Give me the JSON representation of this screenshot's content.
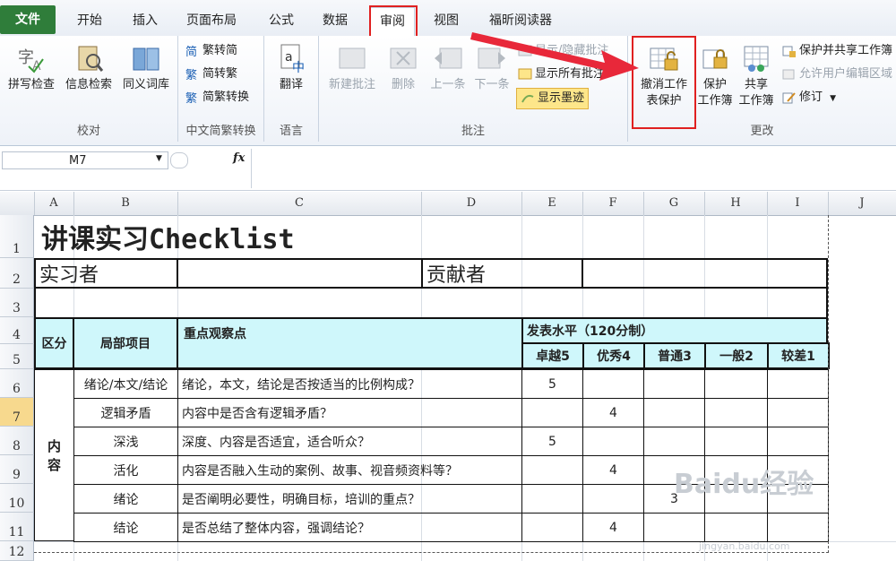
{
  "tabs": {
    "file": "文件",
    "items": [
      "开始",
      "插入",
      "页面布局",
      "公式",
      "数据",
      "审阅",
      "视图",
      "福昕阅读器"
    ],
    "active": "审阅"
  },
  "ribbon": {
    "proofing": {
      "label": "校对",
      "spell": "拼写检查",
      "research": "信息检索",
      "thesaurus": "同义词库"
    },
    "chinese": {
      "label": "中文简繁转换",
      "t2s": "繁转简",
      "s2t": "简转繁",
      "convert": "简繁转换"
    },
    "language": {
      "label": "语言",
      "translate": "翻译"
    },
    "comments": {
      "label": "批注",
      "new": "新建批注",
      "delete": "删除",
      "prev": "上一条",
      "next": "下一条",
      "show_hide": "显示/隐藏批注",
      "show_all": "显示所有批注",
      "show_ink": "显示墨迹"
    },
    "changes": {
      "label": "更改",
      "unprotect_l1": "撤消工作",
      "unprotect_l2": "表保护",
      "protect_wb_l1": "保护",
      "protect_wb_l2": "工作簿",
      "share_l1": "共享",
      "share_l2": "工作簿",
      "protect_share": "保护并共享工作簿",
      "allow_edit": "允许用户编辑区域",
      "track": "修订"
    }
  },
  "formula_bar": {
    "cell_ref": "M7",
    "fx": "fx",
    "value": ""
  },
  "columns": [
    "A",
    "B",
    "C",
    "D",
    "E",
    "F",
    "G",
    "H",
    "I",
    "J"
  ],
  "rows": [
    "1",
    "2",
    "3",
    "4",
    "5",
    "6",
    "7",
    "8",
    "9",
    "10",
    "11",
    "12"
  ],
  "selected_row": "7",
  "sheet": {
    "title": "讲课实习Checklist",
    "intern_label": "实习者",
    "contributor_label": "贡献者",
    "h_area": "区分",
    "h_item": "局部项目",
    "h_point": "重点观察点",
    "h_level": "发表水平（120分制）",
    "levels": [
      "卓越5",
      "优秀4",
      "普通3",
      "一般2",
      "较差1"
    ],
    "area_value": "内\n容",
    "rows": [
      {
        "item": "绪论/本文/结论",
        "point": "绪论，本文，结论是否按适当的比例构成？",
        "scores": [
          "5",
          "",
          "",
          "",
          ""
        ]
      },
      {
        "item": "逻辑矛盾",
        "point": "内容中是否含有逻辑矛盾？",
        "scores": [
          "",
          "4",
          "",
          "",
          ""
        ]
      },
      {
        "item": "深浅",
        "point": "深度、内容是否适宜，适合听众？",
        "scores": [
          "5",
          "",
          "",
          "",
          ""
        ]
      },
      {
        "item": "活化",
        "point": "内容是否融入生动的案例、故事、视音频资料等？",
        "scores": [
          "",
          "4",
          "",
          "",
          ""
        ]
      },
      {
        "item": "绪论",
        "point": "是否阐明必要性，明确目标，培训的重点？",
        "scores": [
          "",
          "",
          "3",
          "",
          ""
        ]
      },
      {
        "item": "结论",
        "point": "是否总结了整体内容，强调结论？",
        "scores": [
          "",
          "4",
          "",
          "",
          ""
        ]
      }
    ]
  },
  "watermark": {
    "brand": "Baidu经验",
    "url": "jingyan.baidu.com"
  },
  "colors": {
    "header_fill": "#cff7fb",
    "highlight": "#e02020",
    "file_tab": "#2f7d3a"
  }
}
